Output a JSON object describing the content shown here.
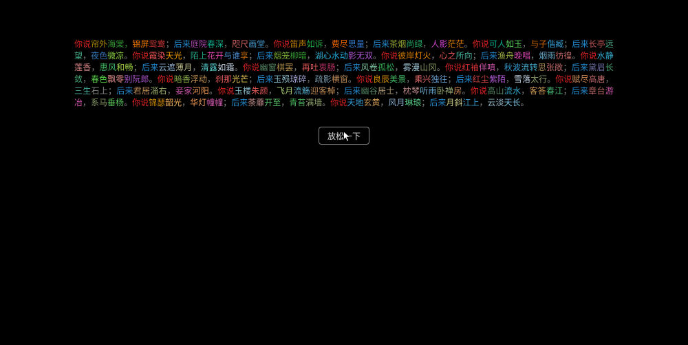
{
  "poem": [
    {
      "t": "你说",
      "c": "#d22"
    },
    {
      "t": "帘外",
      "c": "#a80"
    },
    {
      "t": "海棠",
      "c": "#393"
    },
    {
      "t": "，",
      "c": "#393"
    },
    {
      "t": "锦屏",
      "c": "#e70"
    },
    {
      "t": "鸳鸯",
      "c": "#b33"
    },
    {
      "t": "；",
      "c": "#888"
    },
    {
      "t": "后来",
      "c": "#28c"
    },
    {
      "t": "庭院",
      "c": "#a4a"
    },
    {
      "t": "春深",
      "c": "#1a8"
    },
    {
      "t": "，",
      "c": "#888"
    },
    {
      "t": "咫尺",
      "c": "#d66"
    },
    {
      "t": "画堂",
      "c": "#49c"
    },
    {
      "t": "。",
      "c": "#888"
    },
    {
      "t": "你说",
      "c": "#d22"
    },
    {
      "t": "笛声",
      "c": "#c80"
    },
    {
      "t": "如诉",
      "c": "#2a4"
    },
    {
      "t": "，",
      "c": "#888"
    },
    {
      "t": "费尽",
      "c": "#e60"
    },
    {
      "t": "思量",
      "c": "#37c"
    },
    {
      "t": "；",
      "c": "#888"
    },
    {
      "t": "后来",
      "c": "#28c"
    },
    {
      "t": "茶烟",
      "c": "#9a3"
    },
    {
      "t": "尚绿",
      "c": "#2a6"
    },
    {
      "t": "，",
      "c": "#888"
    },
    {
      "t": "人影",
      "c": "#c4c"
    },
    {
      "t": "茫茫",
      "c": "#e80"
    },
    {
      "t": "。",
      "c": "#888"
    },
    {
      "t": "你说",
      "c": "#d22"
    },
    {
      "t": "可人",
      "c": "#0a8"
    },
    {
      "t": "如玉",
      "c": "#5c5"
    },
    {
      "t": "，",
      "c": "#888"
    },
    {
      "t": "与子",
      "c": "#c60"
    },
    {
      "t": "偕臧",
      "c": "#39c"
    },
    {
      "t": "；",
      "c": "#888"
    },
    {
      "t": "后来",
      "c": "#28c"
    },
    {
      "t": "长亭",
      "c": "#b55"
    },
    {
      "t": "远望",
      "c": "#4a8"
    },
    {
      "t": "，",
      "c": "#888"
    },
    {
      "t": "夜色",
      "c": "#37b"
    },
    {
      "t": "微凉",
      "c": "#8c4"
    },
    {
      "t": "。",
      "c": "#888"
    },
    {
      "t": "你说",
      "c": "#d22"
    },
    {
      "t": "霞染",
      "c": "#e55"
    },
    {
      "t": "天光",
      "c": "#e90"
    },
    {
      "t": "，",
      "c": "#888"
    },
    {
      "t": "陌上",
      "c": "#2a8"
    },
    {
      "t": "花开",
      "c": "#d4a"
    },
    {
      "t": "与谁",
      "c": "#48c"
    },
    {
      "t": "享",
      "c": "#b60"
    },
    {
      "t": "；",
      "c": "#888"
    },
    {
      "t": "后来",
      "c": "#28c"
    },
    {
      "t": "烟笼",
      "c": "#7a3"
    },
    {
      "t": "柳暗",
      "c": "#393"
    },
    {
      "t": "，",
      "c": "#888"
    },
    {
      "t": "湖心",
      "c": "#3ac"
    },
    {
      "t": "水动",
      "c": "#2ad"
    },
    {
      "t": "影无双",
      "c": "#a5c"
    },
    {
      "t": "。",
      "c": "#888"
    },
    {
      "t": "你说",
      "c": "#d22"
    },
    {
      "t": "彼岸",
      "c": "#c70"
    },
    {
      "t": "灯火",
      "c": "#e80"
    },
    {
      "t": "，",
      "c": "#888"
    },
    {
      "t": "心之",
      "c": "#d55"
    },
    {
      "t": "所向",
      "c": "#4a9"
    },
    {
      "t": "；",
      "c": "#888"
    },
    {
      "t": "后来",
      "c": "#28c"
    },
    {
      "t": "渔舟",
      "c": "#9a4"
    },
    {
      "t": "晚唱",
      "c": "#c4a"
    },
    {
      "t": "，",
      "c": "#888"
    },
    {
      "t": "烟雨",
      "c": "#6ac"
    },
    {
      "t": "彷徨",
      "c": "#b66"
    },
    {
      "t": "。",
      "c": "#888"
    },
    {
      "t": "你说",
      "c": "#d22"
    },
    {
      "t": "水静",
      "c": "#3ac"
    },
    {
      "t": "莲香",
      "c": "#d88"
    },
    {
      "t": "，",
      "c": "#888"
    },
    {
      "t": "惠风",
      "c": "#4b6"
    },
    {
      "t": "和畅",
      "c": "#9c4"
    },
    {
      "t": "；",
      "c": "#888"
    },
    {
      "t": "后来",
      "c": "#28c"
    },
    {
      "t": "云遮",
      "c": "#8ac"
    },
    {
      "t": "薄月",
      "c": "#bb8"
    },
    {
      "t": "，",
      "c": "#888"
    },
    {
      "t": "清露",
      "c": "#5cc"
    },
    {
      "t": "如霜",
      "c": "#cde"
    },
    {
      "t": "。",
      "c": "#888"
    },
    {
      "t": "你说",
      "c": "#d22"
    },
    {
      "t": "幽窗",
      "c": "#586"
    },
    {
      "t": "棋罢",
      "c": "#a84"
    },
    {
      "t": "，",
      "c": "#888"
    },
    {
      "t": "再吐",
      "c": "#d55"
    },
    {
      "t": "衷肠",
      "c": "#b36"
    },
    {
      "t": "；",
      "c": "#888"
    },
    {
      "t": "后来",
      "c": "#28c"
    },
    {
      "t": "风卷",
      "c": "#7b9"
    },
    {
      "t": "孤松",
      "c": "#3a5"
    },
    {
      "t": "，",
      "c": "#888"
    },
    {
      "t": "雾漫",
      "c": "#9bc"
    },
    {
      "t": "山冈",
      "c": "#896"
    },
    {
      "t": "。",
      "c": "#888"
    },
    {
      "t": "你说",
      "c": "#d22"
    },
    {
      "t": "红袖",
      "c": "#d33"
    },
    {
      "t": "佯嗔",
      "c": "#c5a"
    },
    {
      "t": "，",
      "c": "#888"
    },
    {
      "t": "秋波",
      "c": "#39c"
    },
    {
      "t": "流转",
      "c": "#4ac"
    },
    {
      "t": "思",
      "c": "#a85"
    },
    {
      "t": "张敞",
      "c": "#b66"
    },
    {
      "t": "；",
      "c": "#888"
    },
    {
      "t": "后来",
      "c": "#28c"
    },
    {
      "t": "黛眉",
      "c": "#669"
    },
    {
      "t": "长敛",
      "c": "#4a7"
    },
    {
      "t": "，",
      "c": "#888"
    },
    {
      "t": "春色",
      "c": "#5c4"
    },
    {
      "t": "飘零",
      "c": "#d88"
    },
    {
      "t": "别阮郎",
      "c": "#a5c"
    },
    {
      "t": "。",
      "c": "#888"
    },
    {
      "t": "你说",
      "c": "#d22"
    },
    {
      "t": "暗香",
      "c": "#8a4"
    },
    {
      "t": "浮动",
      "c": "#c95"
    },
    {
      "t": "，",
      "c": "#888"
    },
    {
      "t": "刹那",
      "c": "#d55"
    },
    {
      "t": "光芒",
      "c": "#ec5"
    },
    {
      "t": "；",
      "c": "#888"
    },
    {
      "t": "后来",
      "c": "#28c"
    },
    {
      "t": "玉殒",
      "c": "#8bc"
    },
    {
      "t": "琼碎",
      "c": "#aad"
    },
    {
      "t": "，",
      "c": "#888"
    },
    {
      "t": "疏影",
      "c": "#79a"
    },
    {
      "t": "横窗",
      "c": "#b85"
    },
    {
      "t": "。",
      "c": "#888"
    },
    {
      "t": "你说",
      "c": "#d22"
    },
    {
      "t": "良辰",
      "c": "#c80"
    },
    {
      "t": "美景",
      "c": "#4b6"
    },
    {
      "t": "，",
      "c": "#888"
    },
    {
      "t": "乘兴",
      "c": "#d66"
    },
    {
      "t": "独往",
      "c": "#69c"
    },
    {
      "t": "；",
      "c": "#888"
    },
    {
      "t": "后来",
      "c": "#28c"
    },
    {
      "t": "红尘",
      "c": "#c44"
    },
    {
      "t": "紫陌",
      "c": "#a5c"
    },
    {
      "t": "，",
      "c": "#888"
    },
    {
      "t": "雪落",
      "c": "#bcd"
    },
    {
      "t": "太行",
      "c": "#896"
    },
    {
      "t": "。",
      "c": "#888"
    },
    {
      "t": "你说",
      "c": "#d22"
    },
    {
      "t": "赋尽",
      "c": "#c85"
    },
    {
      "t": "高唐",
      "c": "#b66"
    },
    {
      "t": "，",
      "c": "#888"
    },
    {
      "t": "三生",
      "c": "#4a9"
    },
    {
      "t": "石上",
      "c": "#888"
    },
    {
      "t": "；",
      "c": "#888"
    },
    {
      "t": "后来",
      "c": "#28c"
    },
    {
      "t": "君居",
      "c": "#b85"
    },
    {
      "t": "淄右",
      "c": "#9a6"
    },
    {
      "t": "，",
      "c": "#888"
    },
    {
      "t": "妾家",
      "c": "#c5a"
    },
    {
      "t": "河阳",
      "c": "#e95"
    },
    {
      "t": "。",
      "c": "#888"
    },
    {
      "t": "你说",
      "c": "#d22"
    },
    {
      "t": "玉楼",
      "c": "#8bc"
    },
    {
      "t": "朱颜",
      "c": "#d55"
    },
    {
      "t": "，",
      "c": "#888"
    },
    {
      "t": "飞月",
      "c": "#ac7"
    },
    {
      "t": "流觞",
      "c": "#5ac"
    },
    {
      "t": "迎客棹",
      "c": "#b85"
    },
    {
      "t": "；",
      "c": "#888"
    },
    {
      "t": "后来",
      "c": "#28c"
    },
    {
      "t": "幽谷",
      "c": "#586"
    },
    {
      "t": "居士",
      "c": "#a97"
    },
    {
      "t": "，",
      "c": "#888"
    },
    {
      "t": "枕琴",
      "c": "#b88"
    },
    {
      "t": "听雨",
      "c": "#6ac"
    },
    {
      "t": "卧禅",
      "c": "#9a7"
    },
    {
      "t": "房",
      "c": "#c85"
    },
    {
      "t": "。",
      "c": "#888"
    },
    {
      "t": "你说",
      "c": "#d22"
    },
    {
      "t": "高山",
      "c": "#586"
    },
    {
      "t": "流水",
      "c": "#3ac"
    },
    {
      "t": "，",
      "c": "#888"
    },
    {
      "t": "客答",
      "c": "#c95"
    },
    {
      "t": "春江",
      "c": "#4b7"
    },
    {
      "t": "；",
      "c": "#888"
    },
    {
      "t": "后来",
      "c": "#28c"
    },
    {
      "t": "章台",
      "c": "#b66"
    },
    {
      "t": "游冶",
      "c": "#c5a"
    },
    {
      "t": "，",
      "c": "#888"
    },
    {
      "t": "系马",
      "c": "#896"
    },
    {
      "t": "垂杨",
      "c": "#5b5"
    },
    {
      "t": "。",
      "c": "#888"
    },
    {
      "t": "你说",
      "c": "#d22"
    },
    {
      "t": "锦瑟",
      "c": "#c80"
    },
    {
      "t": "韶光",
      "c": "#ea5"
    },
    {
      "t": "，",
      "c": "#888"
    },
    {
      "t": "华灯",
      "c": "#e95"
    },
    {
      "t": "幢幢",
      "c": "#c5a"
    },
    {
      "t": "；",
      "c": "#888"
    },
    {
      "t": "后来",
      "c": "#28c"
    },
    {
      "t": "荼蘼",
      "c": "#b88"
    },
    {
      "t": "开至",
      "c": "#5b6"
    },
    {
      "t": "，",
      "c": "#888"
    },
    {
      "t": "青苔",
      "c": "#4a5"
    },
    {
      "t": "满墙",
      "c": "#896"
    },
    {
      "t": "。",
      "c": "#888"
    },
    {
      "t": "你说",
      "c": "#d22"
    },
    {
      "t": "天地",
      "c": "#39c"
    },
    {
      "t": "玄黄",
      "c": "#c95"
    },
    {
      "t": "，",
      "c": "#888"
    },
    {
      "t": "风月",
      "c": "#8ac"
    },
    {
      "t": "琳琅",
      "c": "#5c8"
    },
    {
      "t": "；",
      "c": "#888"
    },
    {
      "t": "后来",
      "c": "#28c"
    },
    {
      "t": "月斜",
      "c": "#cc8"
    },
    {
      "t": "江上",
      "c": "#39c"
    },
    {
      "t": "，",
      "c": "#888"
    },
    {
      "t": "云淡",
      "c": "#9bc"
    },
    {
      "t": "天长",
      "c": "#7bd"
    },
    {
      "t": "。",
      "c": "#888"
    }
  ],
  "button": {
    "label": "放松一下"
  }
}
